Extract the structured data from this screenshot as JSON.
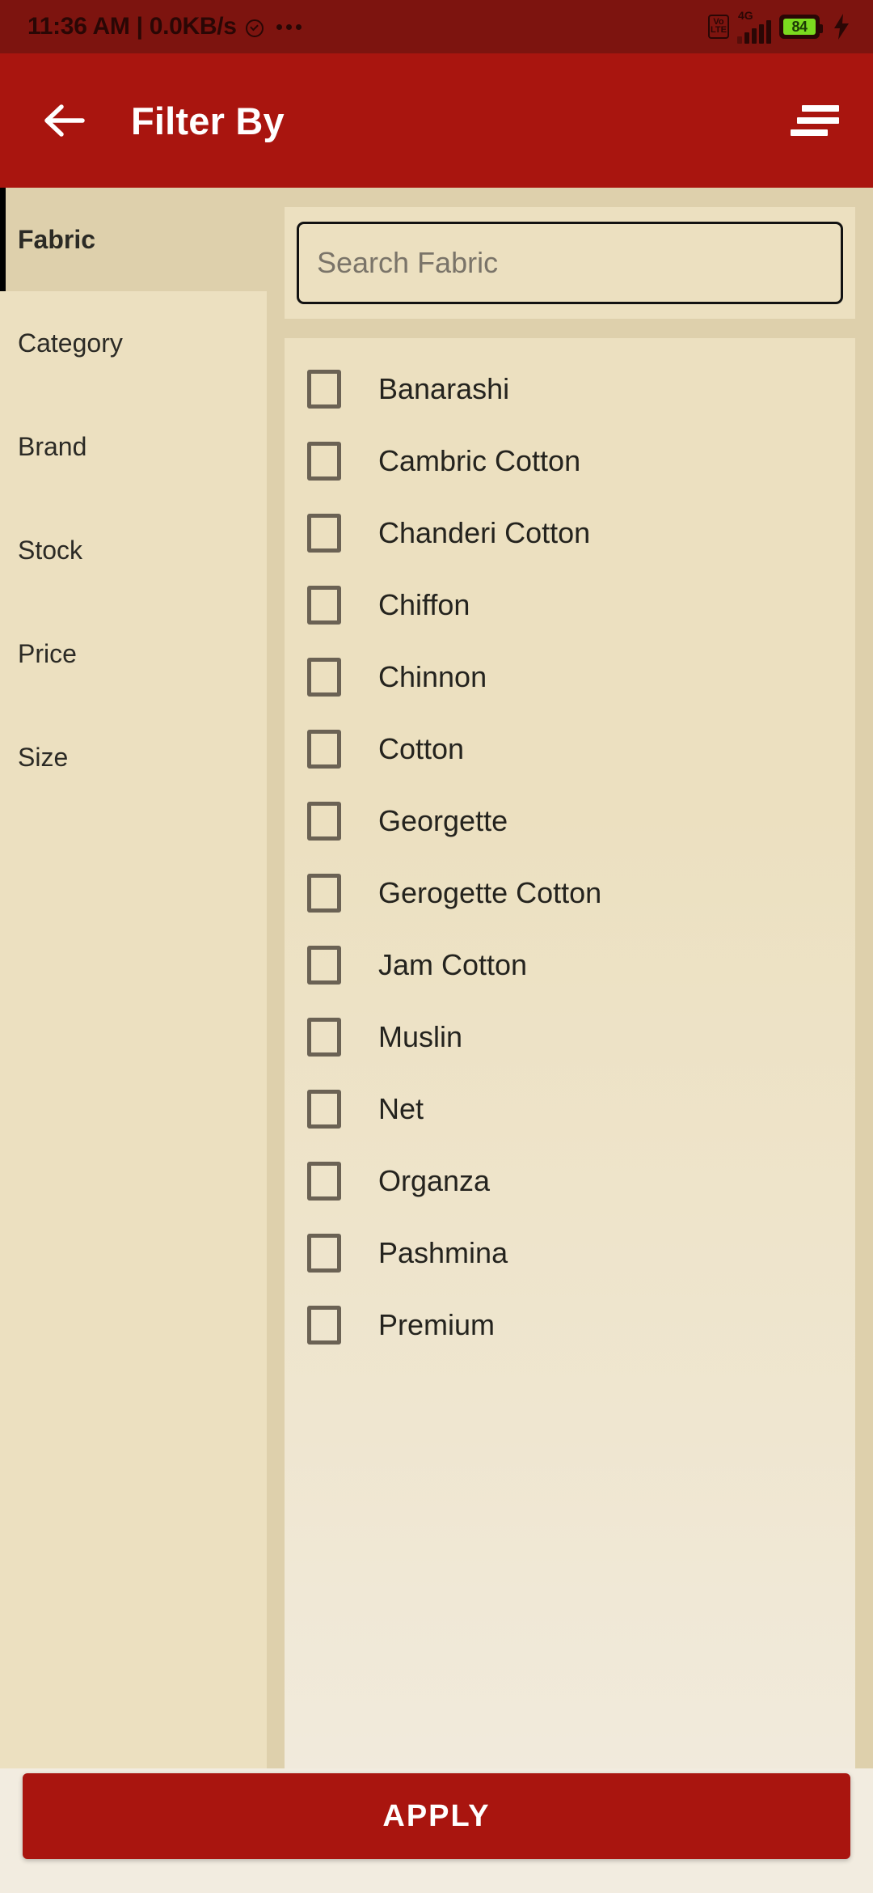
{
  "status_bar": {
    "time": "11:36 AM | 0.0KB/s",
    "alarm_icon": "alarm-clock-icon",
    "more_icon": "more-dots-icon",
    "volte_top": "Vo",
    "volte_bottom": "LTE",
    "network_type": "4G",
    "battery_percent": "84",
    "charging_icon": "charging-bolt-icon",
    "colors": {
      "background": "#7d140f",
      "foreground": "#2a0705",
      "battery_fill": "#7bdb1f"
    }
  },
  "app_bar": {
    "back_icon": "back-arrow-icon",
    "title": "Filter By",
    "menu_icon": "hamburger-menu-icon",
    "colors": {
      "background": "#a9150f",
      "text": "#ffffff"
    }
  },
  "sidebar": {
    "items": [
      {
        "label": "Fabric",
        "selected": true
      },
      {
        "label": "Category",
        "selected": false
      },
      {
        "label": "Brand",
        "selected": false
      },
      {
        "label": "Stock",
        "selected": false
      },
      {
        "label": "Price",
        "selected": false
      },
      {
        "label": "Size",
        "selected": false
      }
    ],
    "colors": {
      "background": "#ece0c0",
      "selected_background": "#ded0ac",
      "indicator": "#000000"
    }
  },
  "search": {
    "placeholder": "Search Fabric",
    "value": ""
  },
  "filter_list": {
    "items": [
      {
        "label": "Banarashi",
        "checked": false
      },
      {
        "label": "Cambric Cotton",
        "checked": false
      },
      {
        "label": "Chanderi Cotton",
        "checked": false
      },
      {
        "label": "Chiffon",
        "checked": false
      },
      {
        "label": "Chinnon",
        "checked": false
      },
      {
        "label": "Cotton",
        "checked": false
      },
      {
        "label": "Georgette",
        "checked": false
      },
      {
        "label": "Gerogette Cotton",
        "checked": false
      },
      {
        "label": "Jam Cotton",
        "checked": false
      },
      {
        "label": "Muslin",
        "checked": false
      },
      {
        "label": "Net",
        "checked": false
      },
      {
        "label": "Organza",
        "checked": false
      },
      {
        "label": "Pashmina",
        "checked": false
      },
      {
        "label": "Premium",
        "checked": false
      }
    ]
  },
  "footer": {
    "apply_label": "APPLY",
    "colors": {
      "button": "#a9150f",
      "text": "#ffffff"
    }
  }
}
